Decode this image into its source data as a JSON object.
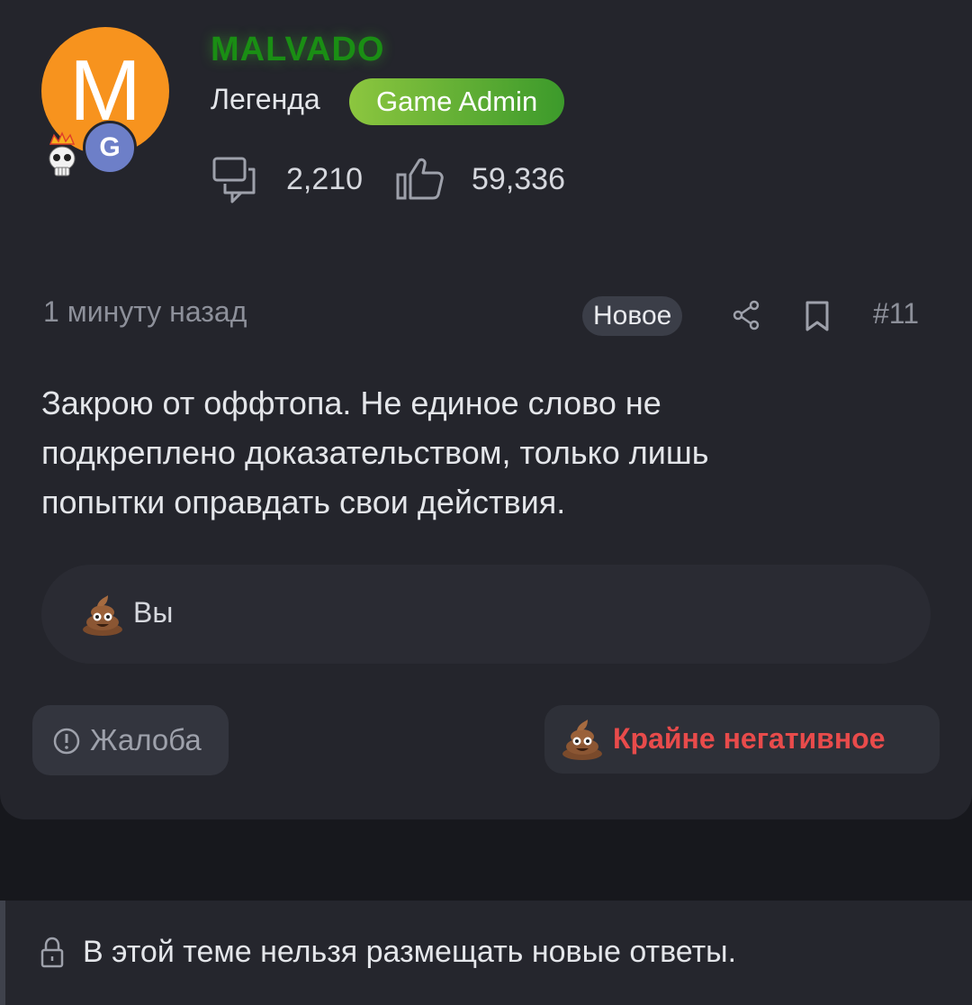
{
  "post": {
    "author": {
      "avatar_letter": "M",
      "avatar_color": "#f7931e",
      "username": "MALVADO",
      "username_color": "#1a8e14",
      "rank": "Легенда",
      "role": "Game Admin",
      "badge_letter": "G",
      "messages_count": "2,210",
      "reactions_count": "59,336"
    },
    "time": "1 минуту назад",
    "new_label": "Новое",
    "post_number": "#11",
    "message_lines": [
      "Закрою от оффтопа. Не единое слово не",
      "подкреплено доказательством, только лишь",
      "попытки оправдать свои действия."
    ],
    "reactions": {
      "user": "Вы",
      "emoji": "poop-emoji"
    },
    "actions": {
      "report_label": "Жалоба",
      "reaction_label": "Крайне негативное",
      "reaction_color": "#e84b4b"
    }
  },
  "thread": {
    "locked_message": "В этой теме нельзя размещать новые ответы."
  }
}
